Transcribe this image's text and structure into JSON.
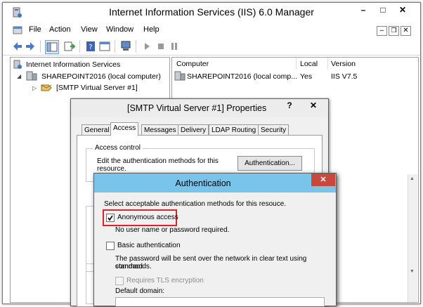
{
  "window": {
    "title": "Internet Information Services (IIS) 6.0 Manager",
    "menu": [
      "File",
      "Action",
      "View",
      "Window",
      "Help"
    ]
  },
  "tree": {
    "root": "Internet Information Services",
    "computer": "SHAREPOINT2016 (local computer)",
    "server": "[SMTP Virtual Server #1]"
  },
  "list": {
    "columns": [
      "Computer",
      "Local",
      "Version"
    ],
    "rows": [
      {
        "computer": "SHAREPOINT2016 (local comp...",
        "local": "Yes",
        "version": "IIS V7.5"
      }
    ]
  },
  "props_dialog": {
    "title": "[SMTP Virtual Server #1] Properties",
    "help_btn": "?",
    "tabs": [
      "General",
      "Access",
      "Messages",
      "Delivery",
      "LDAP Routing",
      "Security"
    ],
    "active_tab": "Access",
    "group_access_control": "Access control",
    "access_text_1": "Edit the authentication methods for this",
    "access_text_2": "resource.",
    "auth_button": "Authentication..."
  },
  "auth_dialog": {
    "title": "Authentication",
    "intro": "Select acceptable authentication methods for this resouce.",
    "anonymous_label": "Anonymous access",
    "anonymous_checked": true,
    "anonymous_desc": "No user name or password required.",
    "basic_label": "Basic authentication",
    "basic_checked": false,
    "basic_desc_1": "The password will be sent over the network in clear text using standard",
    "basic_desc_2": "commands.",
    "tls_label": "Requires TLS encryption",
    "default_domain_label": "Default domain:",
    "highlight_color": "#e0202a",
    "titlebar_color": "#78c4ea",
    "close_color": "#c9483e"
  }
}
